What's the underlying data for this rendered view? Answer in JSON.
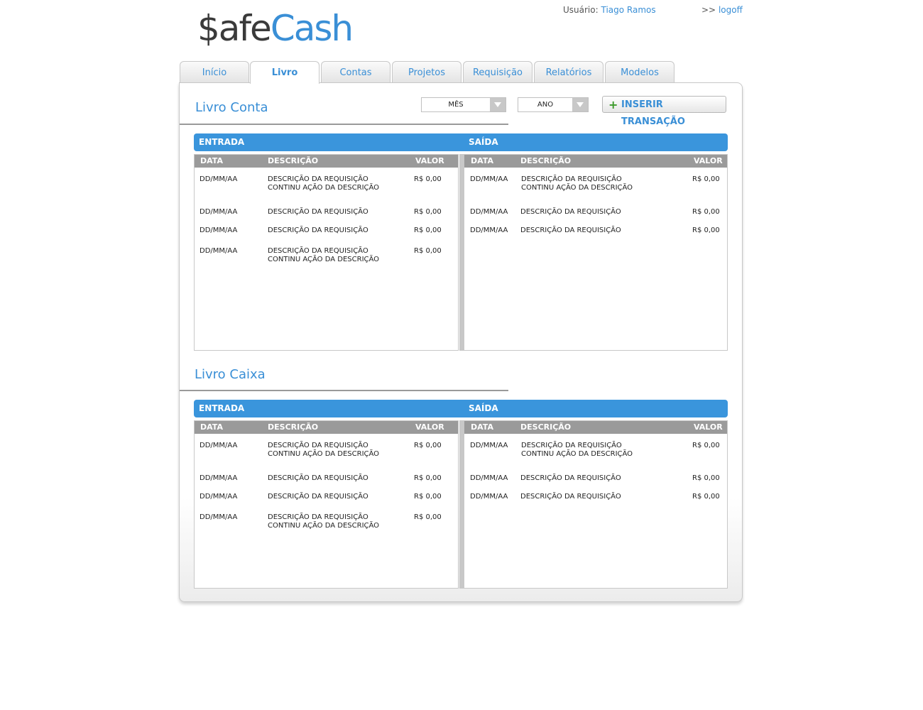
{
  "logo": {
    "part1": "$afe",
    "part2": "Cash"
  },
  "header": {
    "user_label": "Usuário:",
    "user_name": "Tiago Ramos",
    "logoff_prefix": ">>",
    "logoff": "logoff"
  },
  "tabs": [
    "Início",
    "Livro",
    "Contas",
    "Projetos",
    "Requisição",
    "Relatórios",
    "Modelos"
  ],
  "active_tab": "Livro",
  "filters": {
    "month": "MÊS",
    "year": "ANO"
  },
  "insert_button": "INSERIR TRANSAÇÃO",
  "colors": {
    "accent": "#3a8fd6",
    "bar": "#3a95dc",
    "header_gray": "#9a9a9a",
    "plus": "#3c9a2a"
  },
  "sections": [
    {
      "title": "Livro Conta",
      "entrada_label": "ENTRADA",
      "saida_label": "SAÍDA",
      "columns": {
        "date": "DATA",
        "desc": "DESCRIÇÃO",
        "value": "VALOR"
      },
      "entrada_rows": [
        {
          "date": "DD/MM/AA",
          "desc": "DESCRIÇÃO DA REQUISIÇÃO CONTINU AÇÃO DA DESCRIÇÃO",
          "value": "R$ 0,00"
        },
        {
          "date": "DD/MM/AA",
          "desc": "DESCRIÇÃO DA REQUISIÇÃO",
          "value": "R$ 0,00"
        },
        {
          "date": "DD/MM/AA",
          "desc": "DESCRIÇÃO DA REQUISIÇÃO",
          "value": "R$ 0,00"
        },
        {
          "date": "DD/MM/AA",
          "desc": "DESCRIÇÃO DA REQUISIÇÃO CONTINU AÇÃO DA DESCRIÇÃO",
          "value": "R$ 0,00"
        }
      ],
      "saida_rows": [
        {
          "date": "DD/MM/AA",
          "desc": "DESCRIÇÃO DA REQUISIÇÃO CONTINU AÇÃO DA DESCRIÇÃO",
          "value": "R$ 0,00"
        },
        {
          "date": "DD/MM/AA",
          "desc": "DESCRIÇÃO DA REQUISIÇÃO",
          "value": "R$ 0,00"
        },
        {
          "date": "DD/MM/AA",
          "desc": "DESCRIÇÃO DA REQUISIÇÃO",
          "value": "R$ 0,00"
        }
      ]
    },
    {
      "title": "Livro Caixa",
      "entrada_label": "ENTRADA",
      "saida_label": "SAÍDA",
      "columns": {
        "date": "DATA",
        "desc": "DESCRIÇÃO",
        "value": "VALOR"
      },
      "entrada_rows": [
        {
          "date": "DD/MM/AA",
          "desc": "DESCRIÇÃO DA REQUISIÇÃO CONTINU AÇÃO DA DESCRIÇÃO",
          "value": "R$ 0,00"
        },
        {
          "date": "DD/MM/AA",
          "desc": "DESCRIÇÃO DA REQUISIÇÃO",
          "value": "R$ 0,00"
        },
        {
          "date": "DD/MM/AA",
          "desc": "DESCRIÇÃO DA REQUISIÇÃO",
          "value": "R$ 0,00"
        },
        {
          "date": "DD/MM/AA",
          "desc": "DESCRIÇÃO DA REQUISIÇÃO CONTINU AÇÃO DA DESCRIÇÃO",
          "value": "R$ 0,00"
        }
      ],
      "saida_rows": [
        {
          "date": "DD/MM/AA",
          "desc": "DESCRIÇÃO DA REQUISIÇÃO CONTINU AÇÃO DA DESCRIÇÃO",
          "value": "R$ 0,00"
        },
        {
          "date": "DD/MM/AA",
          "desc": "DESCRIÇÃO DA REQUISIÇÃO",
          "value": "R$ 0,00"
        },
        {
          "date": "DD/MM/AA",
          "desc": "DESCRIÇÃO DA REQUISIÇÃO",
          "value": "R$ 0,00"
        }
      ]
    }
  ]
}
